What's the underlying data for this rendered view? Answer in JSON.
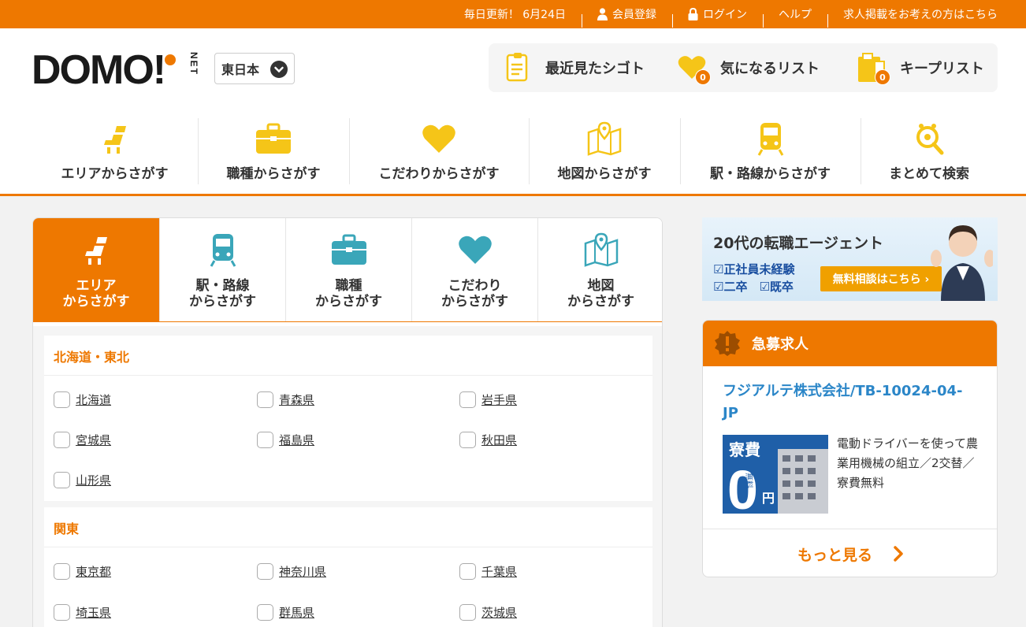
{
  "topbar": {
    "update_text": "毎日更新！ 6月24日",
    "register": "会員登録",
    "login": "ログイン",
    "help": "ヘルプ",
    "post_jobs": "求人掲載をお考えの方はこちら"
  },
  "header": {
    "logo_text": "DOMO!",
    "logo_sub": "NET",
    "region_label": "東日本",
    "quick": [
      {
        "label": "最近見たシゴト",
        "icon": "document-icon"
      },
      {
        "label": "気になるリスト",
        "icon": "heart-icon",
        "count": "0"
      },
      {
        "label": "キープリスト",
        "icon": "folder-icon",
        "count": "0"
      }
    ],
    "nav": [
      {
        "label": "エリアからさがす",
        "icon": "seat-icon"
      },
      {
        "label": "職種からさがす",
        "icon": "briefcase-icon"
      },
      {
        "label": "こだわりからさがす",
        "icon": "heart-icon"
      },
      {
        "label": "地図からさがす",
        "icon": "map-icon"
      },
      {
        "label": "駅・路線からさがす",
        "icon": "train-icon"
      },
      {
        "label": "まとめて検索",
        "icon": "search-gear-icon"
      }
    ]
  },
  "search": {
    "tabs": [
      {
        "line1": "エリア",
        "line2": "からさがす"
      },
      {
        "line1": "駅・路線",
        "line2": "からさがす"
      },
      {
        "line1": "職種",
        "line2": "からさがす"
      },
      {
        "line1": "こだわり",
        "line2": "からさがす"
      },
      {
        "line1": "地図",
        "line2": "からさがす"
      }
    ],
    "regions": [
      {
        "name": "北海道・東北",
        "prefs": [
          "北海道",
          "青森県",
          "岩手県",
          "宮城県",
          "福島県",
          "秋田県",
          "山形県"
        ]
      },
      {
        "name": "関東",
        "prefs": [
          "東京都",
          "神奈川県",
          "千葉県",
          "埼玉県",
          "群馬県",
          "茨城県"
        ]
      }
    ]
  },
  "banner": {
    "title": "20代の転職エージェント",
    "check1": "☑正社員未経験",
    "check2": "☑二卒　☑既卒",
    "button": "無料相談はこちら ›"
  },
  "urgent": {
    "header": "急募求人",
    "company": "フジアルテ株式会社/TB-10024-04-JP",
    "thumb_text1": "寮費",
    "thumb_text2": "無料",
    "thumb_text3": "0",
    "thumb_text4": "円",
    "description": "電動ドライバーを使って農業用機械の組立／2交替／寮費無料",
    "more": "もっと見る"
  },
  "colors": {
    "brand": "#ee7800",
    "icon_yellow": "#f5c518",
    "icon_teal": "#3aa6b9",
    "link_blue": "#2b86c8"
  }
}
